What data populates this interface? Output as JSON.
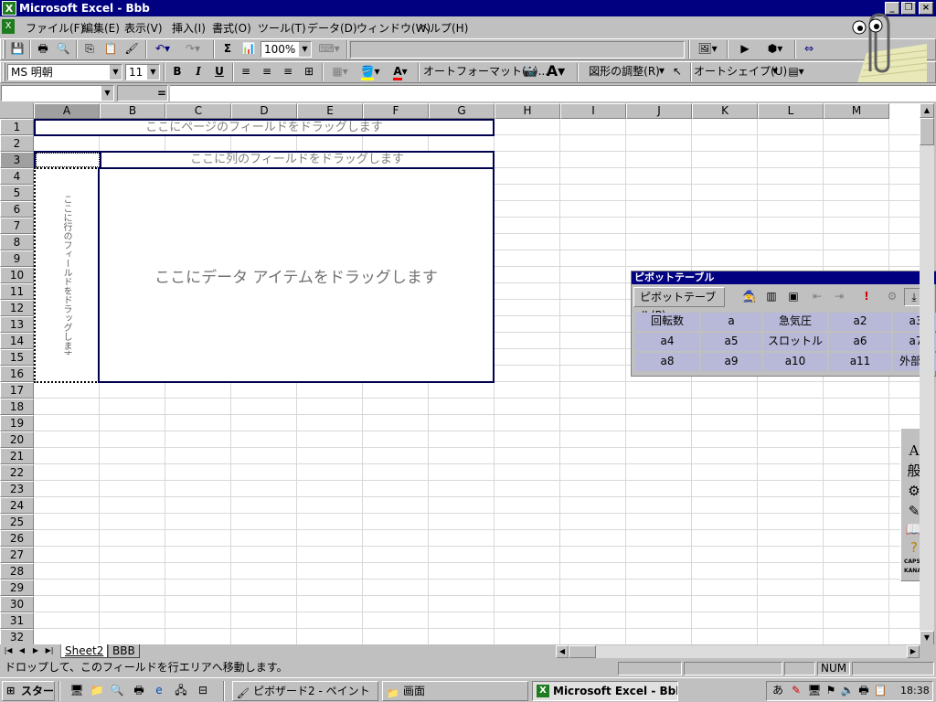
{
  "window": {
    "title": "Microsoft Excel - Bbb",
    "app_icon": "excel-icon"
  },
  "menubar": {
    "items": [
      "ファイル(F)",
      "編集(E)",
      "表示(V)",
      "挿入(I)",
      "書式(O)",
      "ツール(T)",
      "データ(D)",
      "ウィンドウ(W)",
      "ヘルプ(H)"
    ]
  },
  "toolbar_standard": {
    "zoom": "100%"
  },
  "toolbar_format": {
    "font_name": "MS 明朝",
    "font_size": "11",
    "bold": "B",
    "italic": "I",
    "underline": "U",
    "autoformat": "オートフォーマット(A)...",
    "drawing_adjust": "図形の調整(R)",
    "autoshape": "オートシェイプ(U)"
  },
  "formula_bar": {
    "name_box": "",
    "equals": "="
  },
  "grid": {
    "columns": [
      "A",
      "B",
      "C",
      "D",
      "E",
      "F",
      "G",
      "H",
      "I",
      "J",
      "K",
      "L",
      "M"
    ],
    "rows": [
      "1",
      "2",
      "3",
      "4",
      "5",
      "6",
      "7",
      "8",
      "9",
      "10",
      "11",
      "12",
      "13",
      "14",
      "15",
      "16",
      "17",
      "18",
      "19",
      "20",
      "21",
      "22",
      "23",
      "24",
      "25",
      "26",
      "27",
      "28",
      "29",
      "30",
      "31",
      "32"
    ]
  },
  "pivot_layout": {
    "page_drop": "ここにページのフィールドをドラッグします",
    "column_drop": "ここに列のフィールドをドラッグします",
    "row_drop": "ここに行のフィールドをドラッグします",
    "data_drop": "ここにデータ アイテムをドラッグします"
  },
  "pivot_toolbar": {
    "title": "ピボットテーブル",
    "menu": "ピボットテーブル(P)",
    "fields": [
      "回転数",
      "a",
      "急気圧",
      "a2",
      "a3",
      "a4",
      "a5",
      "スロットル",
      "a6",
      "a7",
      "a8",
      "a9",
      "a10",
      "a11",
      "外部電"
    ]
  },
  "sheet_tabs": {
    "tabs": [
      "Sheet2",
      "BBB"
    ]
  },
  "status_bar": {
    "message": "ドロップして、このフィールドを行エリアへ移動します。",
    "num": "NUM"
  },
  "taskbar": {
    "start": "スタート",
    "tasks": [
      "ピボザード2 - ペイント",
      "画面",
      "Microsoft Excel - Bbb"
    ],
    "clock": "18:38"
  },
  "side_toolbar": {
    "labels": [
      "A",
      "般",
      "CAPS",
      "KANA"
    ]
  },
  "colors": {
    "title_bar": "#000080",
    "pivot_field": "#b8b8d8"
  }
}
